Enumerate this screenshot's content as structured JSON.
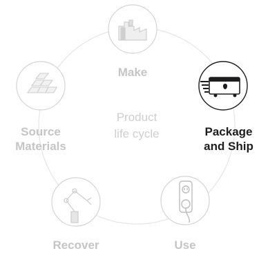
{
  "diagram": {
    "center": {
      "line1": "Product",
      "line2": "life cycle"
    },
    "stages": [
      {
        "id": "make",
        "label_lines": [
          "Make"
        ],
        "icon": "factory-icon",
        "active": false
      },
      {
        "id": "package",
        "label_lines": [
          "Package",
          "and Ship"
        ],
        "icon": "shipping-truck-apple-icon",
        "active": true
      },
      {
        "id": "use",
        "label_lines": [
          "Use"
        ],
        "icon": "power-outlet-icon",
        "active": false
      },
      {
        "id": "recover",
        "label_lines": [
          "Recover"
        ],
        "icon": "robot-arm-icon",
        "active": false
      },
      {
        "id": "source",
        "label_lines": [
          "Source",
          "Materials"
        ],
        "icon": "ingot-stack-icon",
        "active": false
      }
    ],
    "colors": {
      "active": "#1d1d1f",
      "inactive": "#c5c5c5",
      "ring": "#e6e6e6"
    }
  }
}
